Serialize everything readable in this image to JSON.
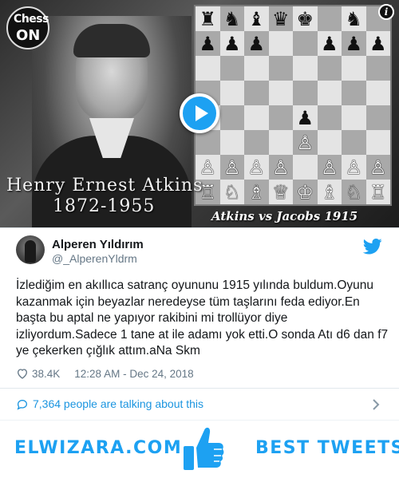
{
  "video": {
    "logo": {
      "line1": "Chess",
      "line2": "ON"
    },
    "name_line1": "Henry Ernest Atkins",
    "name_line2": "1872-1955",
    "caption": "Atkins vs Jacobs 1915",
    "play_icon": "play-icon",
    "info_icon": "info-icon",
    "board": [
      [
        "♜",
        "♞",
        "♝",
        "♛",
        "♚",
        "",
        "♞",
        ""
      ],
      [
        "♟",
        "♟",
        "♟",
        "",
        "",
        "♟",
        "♟",
        "♟"
      ],
      [
        "",
        "",
        "",
        "",
        "",
        "",
        "",
        ""
      ],
      [
        "",
        "",
        "",
        "",
        "",
        "",
        "",
        ""
      ],
      [
        "",
        "",
        "",
        "",
        "♟",
        "",
        "",
        ""
      ],
      [
        "",
        "",
        "",
        "",
        "♙",
        "",
        "",
        ""
      ],
      [
        "♙",
        "♙",
        "♙",
        "♙",
        "",
        "♙",
        "♙",
        "♙"
      ],
      [
        "♖",
        "♘",
        "♗",
        "♕",
        "♔",
        "♗",
        "♘",
        "♖"
      ]
    ]
  },
  "tweet": {
    "display_name": "Alperen Yıldırım",
    "handle": "@_AlperenYldrm",
    "text": "İzlediğim en akıllıca satranç oyununu 1915 yılında buldum.Oyunu kazanmak için beyazlar neredeyse tüm taşlarını feda ediyor.En başta bu aptal ne yapıyor rakibini mi trollüyor diye izliyordum.Sadece 1 tane at ile adamı yok etti.O sonda Atı d6 dan f7 ye çekerken çığlık attım.aNa Skm",
    "likes": "38.4K",
    "timestamp": "12:28 AM - Dec 24, 2018",
    "talking": "7,364 people are talking about this"
  },
  "banner": {
    "site": "ELWIZARA.COM",
    "tagline": "BEST TWEETS"
  },
  "colors": {
    "accent": "#1da1f2",
    "link": "#1b95e0",
    "muted": "#657786",
    "text": "#14171a"
  }
}
